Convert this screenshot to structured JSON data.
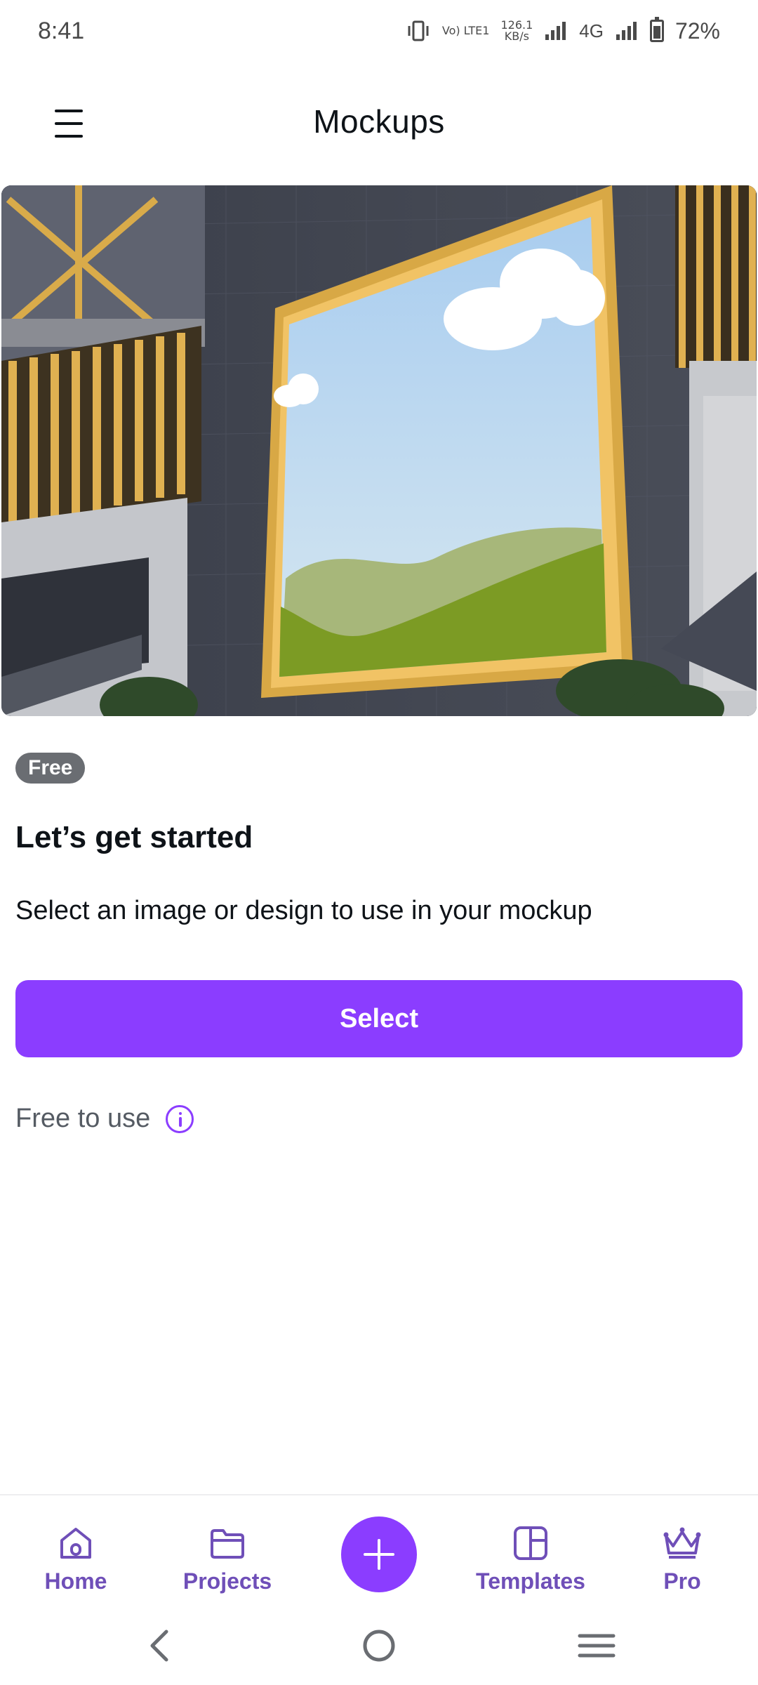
{
  "status_bar": {
    "time": "8:41",
    "volte_label": "Vo) LTE1",
    "speed_value": "126.1",
    "speed_unit": "KB/s",
    "network": "4G",
    "battery": "72%"
  },
  "header": {
    "title": "Mockups",
    "menu_icon": "hamburger-menu-icon"
  },
  "hero": {
    "description_icon": "billboard-mockup-image"
  },
  "content": {
    "badge": "Free",
    "heading": "Let’s get started",
    "subtext": "Select an image or design to use in your mockup",
    "select_label": "Select",
    "free_to_use": "Free to use"
  },
  "bottom_nav": {
    "items": [
      {
        "label": "Home",
        "icon": "home-icon"
      },
      {
        "label": "Projects",
        "icon": "folder-icon"
      },
      {
        "label": "Templates",
        "icon": "templates-icon"
      },
      {
        "label": "Pro",
        "icon": "crown-icon"
      }
    ],
    "fab_icon": "plus-icon"
  },
  "colors": {
    "accent": "#8b3dff",
    "nav_text": "#6f4fb8",
    "badge_bg": "#6a6d72"
  }
}
